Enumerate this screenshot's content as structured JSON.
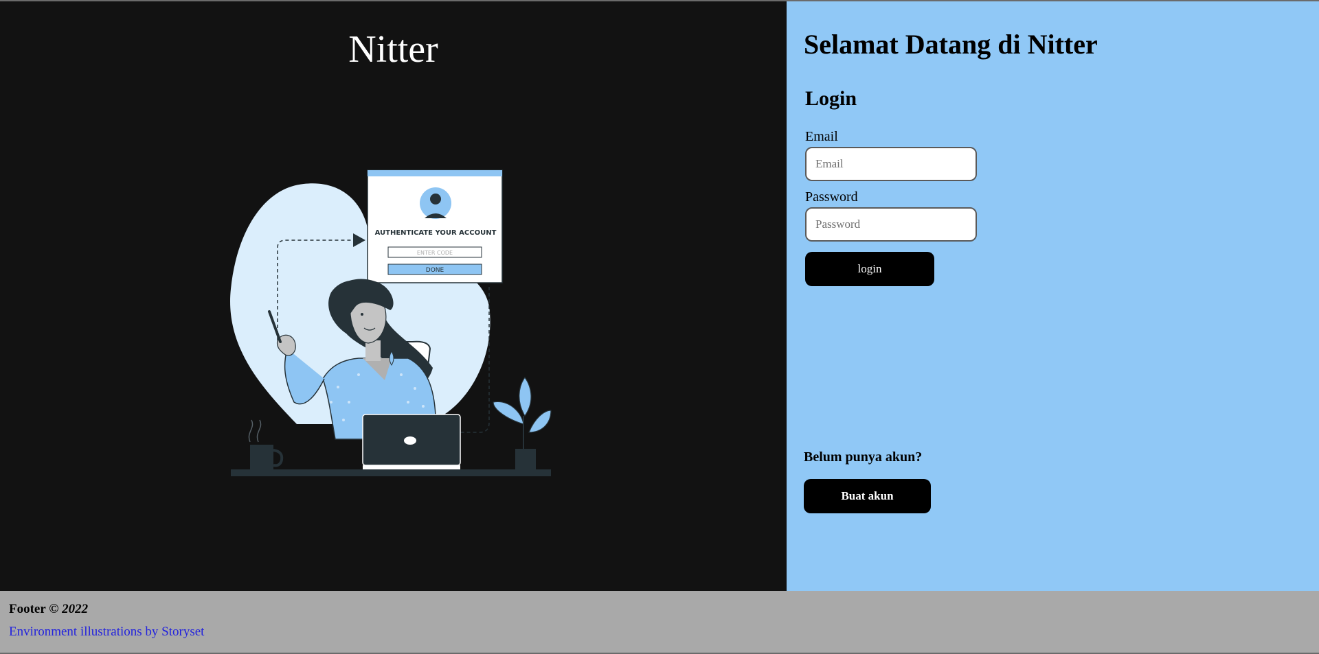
{
  "brand": {
    "title": "Nitter"
  },
  "illustration": {
    "card_title": "AUTHENTICATE YOUR ACCOUNT",
    "code_placeholder": "ENTER CODE",
    "done_label": "DONE"
  },
  "form": {
    "welcome": "Selamat Datang di Nitter",
    "heading": "Login",
    "email_label": "Email",
    "email_placeholder": "Email",
    "email_value": "",
    "password_label": "Password",
    "password_placeholder": "Password",
    "password_value": "",
    "login_button": "login"
  },
  "signup": {
    "question": "Belum punya akun?",
    "button": "Buat akun"
  },
  "footer": {
    "text": "Footer ©",
    "year": "2022",
    "link": "Environment illustrations by Storyset"
  },
  "colors": {
    "left_bg": "#121212",
    "right_bg": "#90c8f6",
    "footer_bg": "#a9a9a9",
    "button_bg": "#000000",
    "link": "#2222dd",
    "accent": "#8ec5f3"
  }
}
